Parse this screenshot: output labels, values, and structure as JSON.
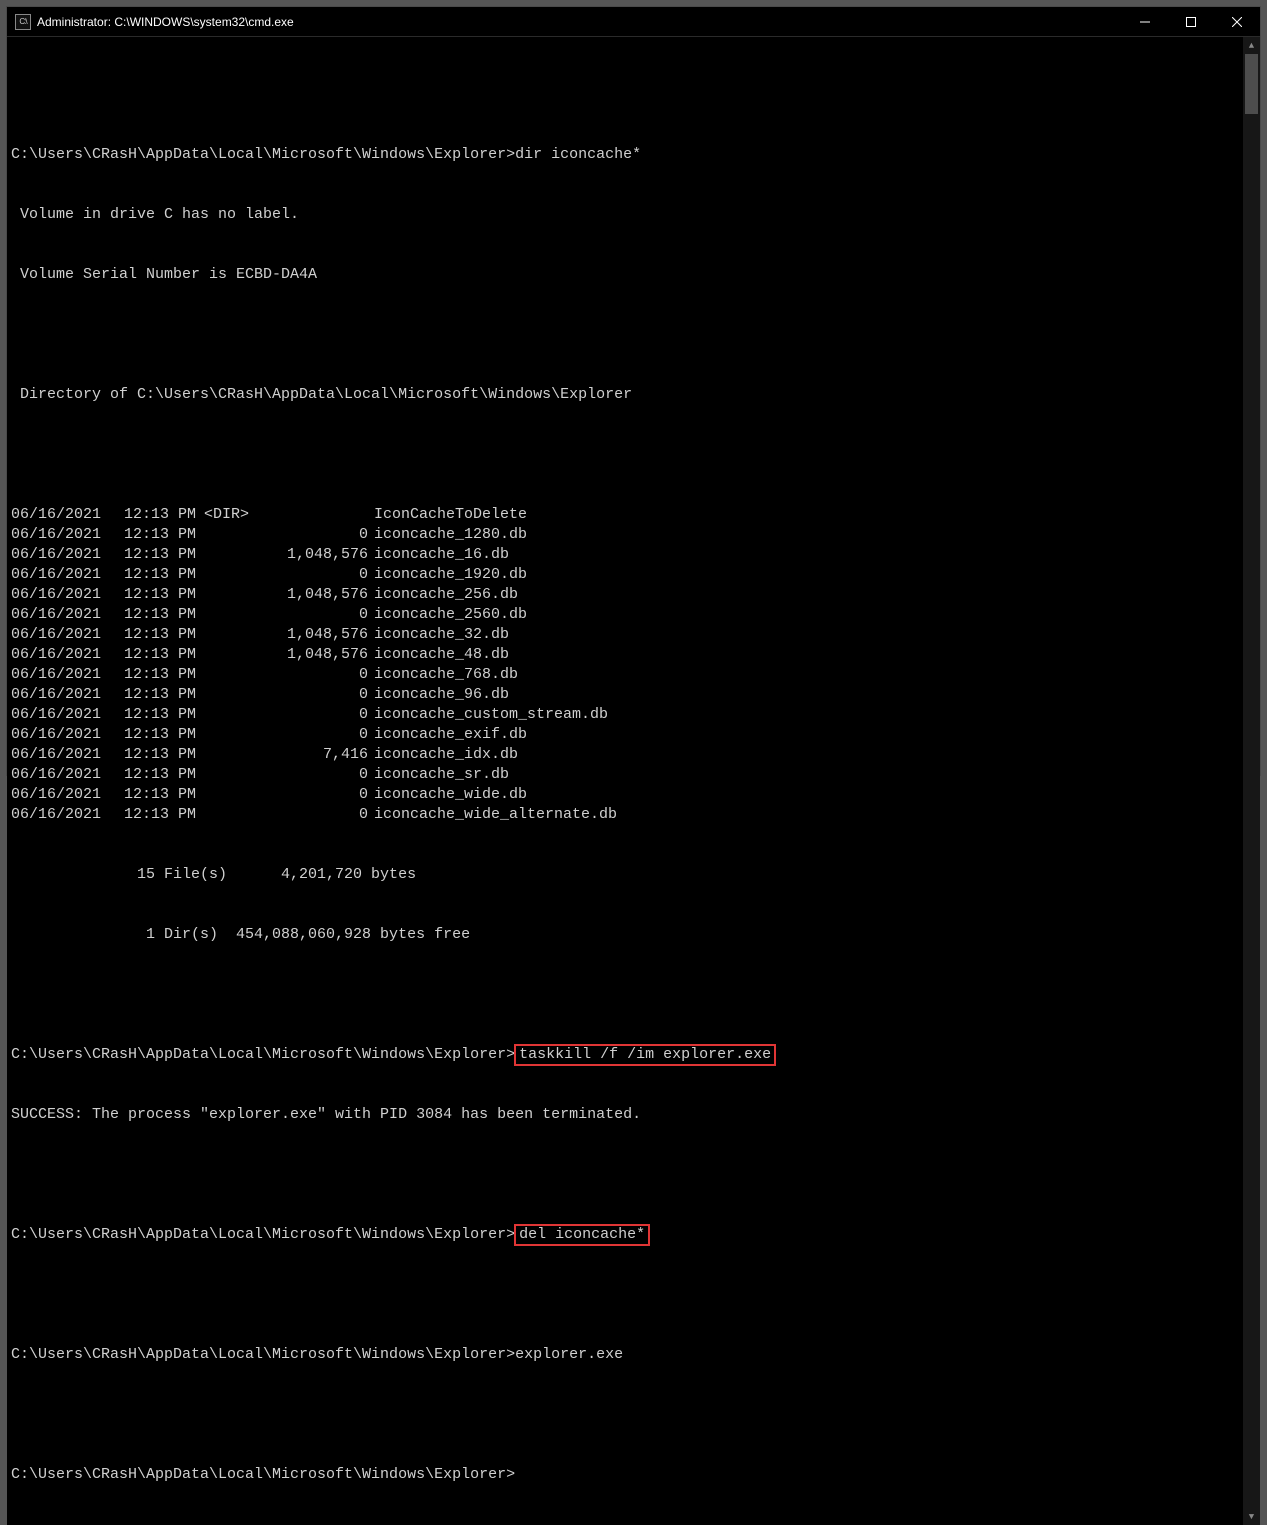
{
  "window": {
    "title": "Administrator: C:\\WINDOWS\\system32\\cmd.exe",
    "icon_label": "cmd-icon"
  },
  "prompt1": "C:\\Users\\CRasH\\AppData\\Local\\Microsoft\\Windows\\Explorer>",
  "cmd1": "dir iconcache*",
  "vol1": " Volume in drive C has no label.",
  "vol2": " Volume Serial Number is ECBD-DA4A",
  "dirof": " Directory of C:\\Users\\CRasH\\AppData\\Local\\Microsoft\\Windows\\Explorer",
  "listing": [
    {
      "date": "06/16/2021",
      "time": "12:13 PM",
      "dir": "<DIR>",
      "size": "",
      "name": "IconCacheToDelete"
    },
    {
      "date": "06/16/2021",
      "time": "12:13 PM",
      "dir": "",
      "size": "0",
      "name": "iconcache_1280.db"
    },
    {
      "date": "06/16/2021",
      "time": "12:13 PM",
      "dir": "",
      "size": "1,048,576",
      "name": "iconcache_16.db"
    },
    {
      "date": "06/16/2021",
      "time": "12:13 PM",
      "dir": "",
      "size": "0",
      "name": "iconcache_1920.db"
    },
    {
      "date": "06/16/2021",
      "time": "12:13 PM",
      "dir": "",
      "size": "1,048,576",
      "name": "iconcache_256.db"
    },
    {
      "date": "06/16/2021",
      "time": "12:13 PM",
      "dir": "",
      "size": "0",
      "name": "iconcache_2560.db"
    },
    {
      "date": "06/16/2021",
      "time": "12:13 PM",
      "dir": "",
      "size": "1,048,576",
      "name": "iconcache_32.db"
    },
    {
      "date": "06/16/2021",
      "time": "12:13 PM",
      "dir": "",
      "size": "1,048,576",
      "name": "iconcache_48.db"
    },
    {
      "date": "06/16/2021",
      "time": "12:13 PM",
      "dir": "",
      "size": "0",
      "name": "iconcache_768.db"
    },
    {
      "date": "06/16/2021",
      "time": "12:13 PM",
      "dir": "",
      "size": "0",
      "name": "iconcache_96.db"
    },
    {
      "date": "06/16/2021",
      "time": "12:13 PM",
      "dir": "",
      "size": "0",
      "name": "iconcache_custom_stream.db"
    },
    {
      "date": "06/16/2021",
      "time": "12:13 PM",
      "dir": "",
      "size": "0",
      "name": "iconcache_exif.db"
    },
    {
      "date": "06/16/2021",
      "time": "12:13 PM",
      "dir": "",
      "size": "7,416",
      "name": "iconcache_idx.db"
    },
    {
      "date": "06/16/2021",
      "time": "12:13 PM",
      "dir": "",
      "size": "0",
      "name": "iconcache_sr.db"
    },
    {
      "date": "06/16/2021",
      "time": "12:13 PM",
      "dir": "",
      "size": "0",
      "name": "iconcache_wide.db"
    },
    {
      "date": "06/16/2021",
      "time": "12:13 PM",
      "dir": "",
      "size": "0",
      "name": "iconcache_wide_alternate.db"
    }
  ],
  "summary_files": "              15 File(s)      4,201,720 bytes",
  "summary_dirs": "               1 Dir(s)  454,088,060,928 bytes free",
  "prompt2": "C:\\Users\\CRasH\\AppData\\Local\\Microsoft\\Windows\\Explorer>",
  "cmd2": "taskkill /f /im explorer.exe",
  "result2": "SUCCESS: The process \"explorer.exe\" with PID 3084 has been terminated.",
  "prompt3": "C:\\Users\\CRasH\\AppData\\Local\\Microsoft\\Windows\\Explorer>",
  "cmd3": "del iconcache*",
  "prompt4": "C:\\Users\\CRasH\\AppData\\Local\\Microsoft\\Windows\\Explorer>",
  "cmd4": "explorer.exe",
  "prompt5": "C:\\Users\\CRasH\\AppData\\Local\\Microsoft\\Windows\\Explorer>"
}
